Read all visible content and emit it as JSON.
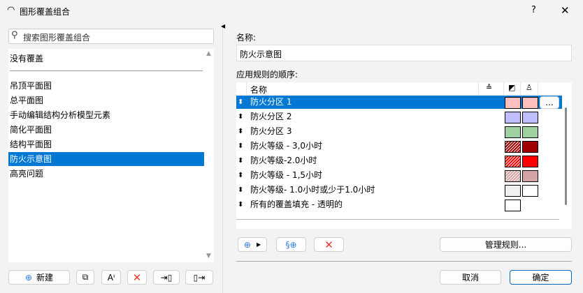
{
  "window": {
    "title": "图形覆盖组合",
    "help": "?",
    "close": "✕"
  },
  "search": {
    "placeholder": "搜索图形覆盖组合"
  },
  "list": {
    "none_item": "没有覆盖",
    "items": [
      "吊顶平面图",
      "总平面图",
      "手动编辑结构分析模型元素",
      "简化平面图",
      "结构平面图",
      "防火示意图",
      "高亮问题"
    ],
    "selected": 5
  },
  "left_buttons": {
    "new": "新建"
  },
  "name_label": "名称:",
  "name_value": "防火示意图",
  "rules_label": "应用规则的顺序:",
  "table": {
    "header_name": "名称",
    "more": "...",
    "rows": [
      {
        "name": "防火分区 1",
        "fill": "#ffbfbf",
        "bg": "#ffbfbf",
        "hatch": false
      },
      {
        "name": "防火分区 2",
        "fill": "#bfbfff",
        "bg": "#bfbfff",
        "hatch": false
      },
      {
        "name": "防火分区 3",
        "fill": "#9fd09f",
        "bg": "#9fd09f",
        "hatch": false
      },
      {
        "name": "防火等级 - 3,0小时",
        "fill": "#a00000",
        "bg": "#a00000",
        "hatch": true
      },
      {
        "name": "防火等级-2.0小时",
        "fill": "#ff0000",
        "bg": "#ff0000",
        "hatch": true
      },
      {
        "name": "防火等级 - 1,5小时",
        "fill": "#d4a4a4",
        "bg": "#d4a4a4",
        "hatch": true
      },
      {
        "name": "防火等级- 1.0小时或少于1.0小时",
        "fill": "#f0f0f0",
        "bg": "#ffffff",
        "hatch": false
      },
      {
        "name": "所有的覆盖填充 - 透明的",
        "fill": "#ffffff",
        "bg": null,
        "hatch": false
      }
    ]
  },
  "manage_rules": "管理规则...",
  "cancel": "取消",
  "ok": "确定"
}
